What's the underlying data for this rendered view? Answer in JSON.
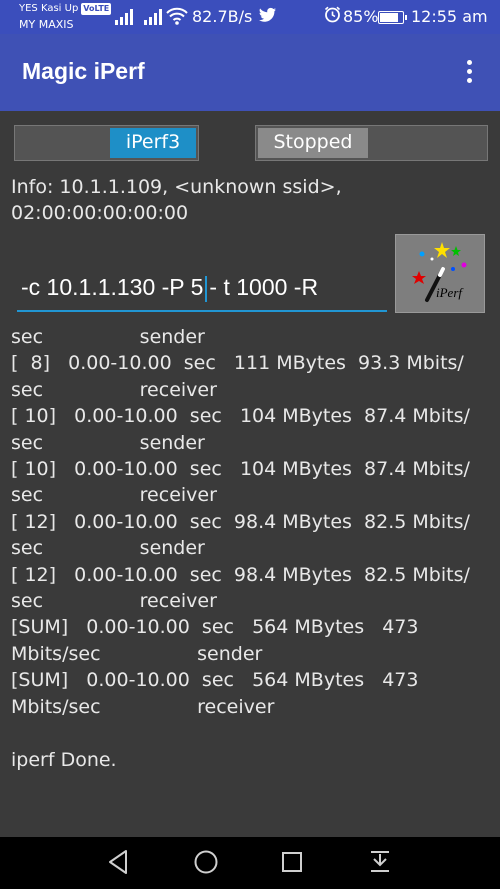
{
  "status_bar": {
    "carrier_line1": "YES Kasi Up",
    "volte": "VoLTE",
    "carrier_line2": "MY MAXIS",
    "net_speed": "82.7B/s",
    "battery_pct": "85%",
    "battery_level": 0.85,
    "time": "12:55 am"
  },
  "app_bar": {
    "title": "Magic iPerf"
  },
  "toggles": {
    "mode_label": "iPerf3",
    "state_label": "Stopped"
  },
  "info": {
    "text": "Info: 10.1.1.109, <unknown ssid>,\n02:00:00:00:00:00"
  },
  "command": {
    "before_cursor": "-c 10.1.1.130 -P 5",
    "after_cursor": "- t 1000 -R"
  },
  "iperf_button": {
    "label": "iPerf"
  },
  "output": {
    "lines": [
      "sec                sender",
      "[  8]   0.00-10.00  sec   111 MBytes  93.3 Mbits/",
      "sec                receiver",
      "[ 10]   0.00-10.00  sec   104 MBytes  87.4 Mbits/",
      "sec                sender",
      "[ 10]   0.00-10.00  sec   104 MBytes  87.4 Mbits/",
      "sec                receiver",
      "[ 12]   0.00-10.00  sec  98.4 MBytes  82.5 Mbits/",
      "sec                sender",
      "[ 12]   0.00-10.00  sec  98.4 MBytes  82.5 Mbits/",
      "sec                receiver",
      "[SUM]   0.00-10.00  sec   564 MBytes   473",
      "Mbits/sec                sender",
      "[SUM]   0.00-10.00  sec   564 MBytes   473",
      "Mbits/sec                receiver",
      "",
      "iperf Done."
    ]
  },
  "nav": {
    "back": "back-icon",
    "home": "home-icon",
    "recents": "recents-icon",
    "notifications": "notification-pull-icon"
  }
}
